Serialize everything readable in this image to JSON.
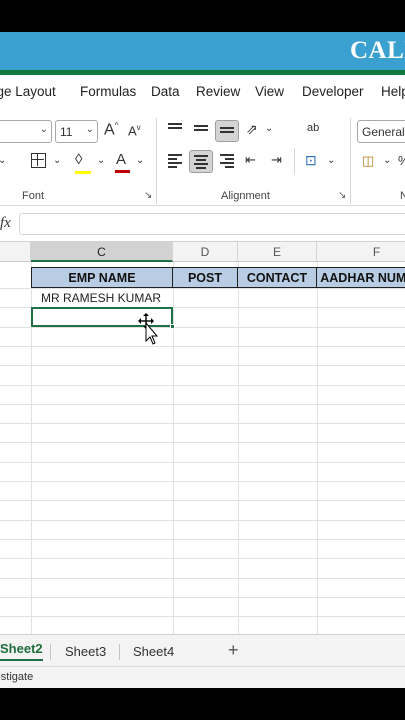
{
  "banner": {
    "title": "CALL"
  },
  "ribbon_tabs": [
    "Page Layout",
    "Formulas",
    "Data",
    "Review",
    "View",
    "Developer",
    "Help"
  ],
  "ribbon": {
    "font_name": "",
    "font_size": "11",
    "number_format": "General",
    "increase_font": "A",
    "decrease_font": "A",
    "font_group": "Font",
    "alignment_group": "Alignment",
    "wrap_icon": "ab",
    "font_color": "#c00000",
    "fill_color": "#ffff00"
  },
  "formula_bar": {
    "fx": "fx",
    "value": ""
  },
  "columns": [
    "C",
    "D",
    "E",
    "F"
  ],
  "active_column": "C",
  "table": {
    "headers": [
      "EMP NAME",
      "POST",
      "CONTACT",
      "AADHAR NUMBER"
    ],
    "rows": [
      [
        "MR RAMESH KUMAR",
        "",
        "",
        ""
      ]
    ]
  },
  "sheet_tabs": [
    "Sheet2",
    "Sheet3",
    "Sheet4"
  ],
  "active_sheet": "Sheet2",
  "status": {
    "text": "Investigate"
  },
  "colors": {
    "banner": "#3aa0cf",
    "accent": "#1e7145",
    "header_fill": "#b8cce4"
  }
}
